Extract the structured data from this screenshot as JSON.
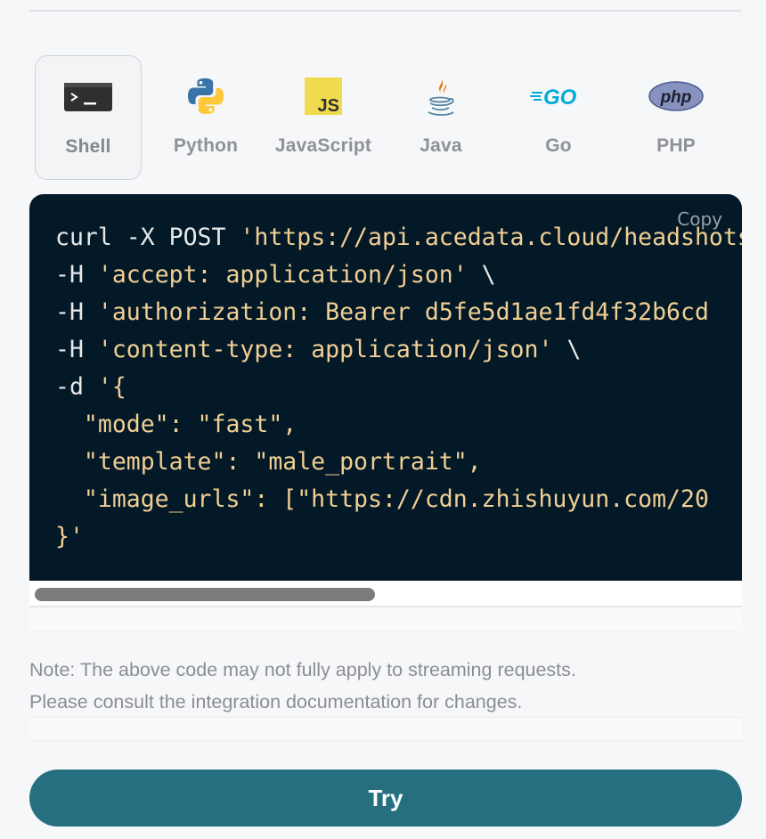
{
  "languages": [
    {
      "label": "Shell",
      "icon": "terminal-icon",
      "active": true
    },
    {
      "label": "Python",
      "icon": "python-icon",
      "active": false
    },
    {
      "label": "JavaScript",
      "icon": "javascript-icon",
      "active": false
    },
    {
      "label": "Java",
      "icon": "java-icon",
      "active": false
    },
    {
      "label": "Go",
      "icon": "go-icon",
      "active": false
    },
    {
      "label": "PHP",
      "icon": "php-icon",
      "active": false
    }
  ],
  "code": {
    "copy_label": "Copy",
    "lines": [
      [
        {
          "t": "curl -X POST ",
          "c": "plain"
        },
        {
          "t": "'https://api.acedata.cloud/headshots/generate' \\",
          "c": "str"
        }
      ],
      [
        {
          "t": "-H ",
          "c": "plain"
        },
        {
          "t": "'accept: application/json'",
          "c": "str"
        },
        {
          "t": " \\",
          "c": "plain"
        }
      ],
      [
        {
          "t": "-H ",
          "c": "plain"
        },
        {
          "t": "'authorization: Bearer d5fe5d1ae1fd4f32b6cd",
          "c": "str"
        }
      ],
      [
        {
          "t": "-H ",
          "c": "plain"
        },
        {
          "t": "'content-type: application/json'",
          "c": "str"
        },
        {
          "t": " \\",
          "c": "plain"
        }
      ],
      [
        {
          "t": "-d ",
          "c": "plain"
        },
        {
          "t": "'{",
          "c": "str"
        }
      ],
      [
        {
          "t": "  \"mode\": \"fast\",",
          "c": "str"
        }
      ],
      [
        {
          "t": "  \"template\": \"male_portrait\",",
          "c": "str"
        }
      ],
      [
        {
          "t": "  \"image_urls\": [\"https://cdn.zhishuyun.com/20",
          "c": "str"
        }
      ],
      [
        {
          "t": "}'",
          "c": "str"
        }
      ]
    ]
  },
  "note": {
    "line1": "Note: The above code may not fully apply to streaming requests.",
    "line2": "Please consult the integration documentation for changes."
  },
  "try_button": {
    "label": "Try"
  },
  "colors": {
    "code_bg": "#031928",
    "string": "#f1cf93",
    "button": "#266f80"
  }
}
